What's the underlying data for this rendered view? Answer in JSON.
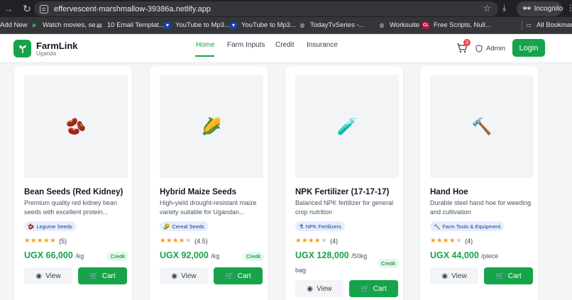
{
  "browser": {
    "url": "effervescent-marshmallow-39386a.netlify.app",
    "incognito_label": "Incognito",
    "bookmarks": [
      {
        "label": "Add New",
        "icon": "add-icon"
      },
      {
        "label": "Watch movies, se...",
        "icon": "play-icon"
      },
      {
        "label": "10 Email Templat...",
        "icon": "doc-icon"
      },
      {
        "label": "YouTube to Mp3...",
        "icon": "shield-icon"
      },
      {
        "label": "YouTube to Mp3...",
        "icon": "shield-icon"
      },
      {
        "label": "TodayTvSeries -...",
        "icon": "globe-icon"
      },
      {
        "label": "Worksuite",
        "icon": "globe-icon"
      },
      {
        "label": "Free Scripts, Null...",
        "icon": "cl-icon"
      },
      {
        "label": "All Bookmarks",
        "icon": "folder-icon"
      }
    ]
  },
  "app": {
    "brand": "FarmLink",
    "brand_sub": "Uganda",
    "nav": [
      "Home",
      "Farm Inputs",
      "Credit",
      "Insurance"
    ],
    "cart_count": "3",
    "admin_label": "Admin",
    "login_label": "Login",
    "colors": {
      "primary": "#16a34a",
      "badge": "#ef4444"
    }
  },
  "products": [
    {
      "icon": "🫘",
      "name": "Bean Seeds (Red Kidney)",
      "desc": "Premium quality red kidney bean seeds with excellent protein...",
      "cat_icon": "🫘",
      "category": "Legume Seeds",
      "rating": 5,
      "rating_label": "(5)",
      "price": "UGX 66,000",
      "unit": "/kg",
      "credit": "Credit",
      "view": "View",
      "cart": "Cart"
    },
    {
      "icon": "🌽",
      "name": "Hybrid Maize Seeds",
      "desc": "High-yield drought-resistant maize variety suitable for Ugandan...",
      "cat_icon": "🌽",
      "category": "Cereal Seeds",
      "rating": 4.5,
      "rating_label": "(4.5)",
      "price": "UGX 92,000",
      "unit": "/kg",
      "credit": "Credit",
      "view": "View",
      "cart": "Cart"
    },
    {
      "icon": "🧪",
      "name": "NPK Fertilizer (17-17-17)",
      "desc": "Balanced NPK fertilizer for general crop nutrition",
      "cat_icon": "⚗",
      "category": "NPK Fertilizers",
      "rating": 4,
      "rating_label": "(4)",
      "price": "UGX 128,000",
      "unit": "/50kg",
      "unit2": "bag",
      "credit": "Credit",
      "view": "View",
      "cart": "Cart"
    },
    {
      "icon": "🔨",
      "name": "Hand Hoe",
      "desc": "Durable steel hand hoe for weeding and cultivation",
      "cat_icon": "🔨",
      "category": "Farm Tools & Equipment",
      "rating": 4,
      "rating_label": "(4)",
      "price": "UGX 44,000",
      "unit": "/piece",
      "view": "View",
      "cart": "Cart"
    }
  ]
}
